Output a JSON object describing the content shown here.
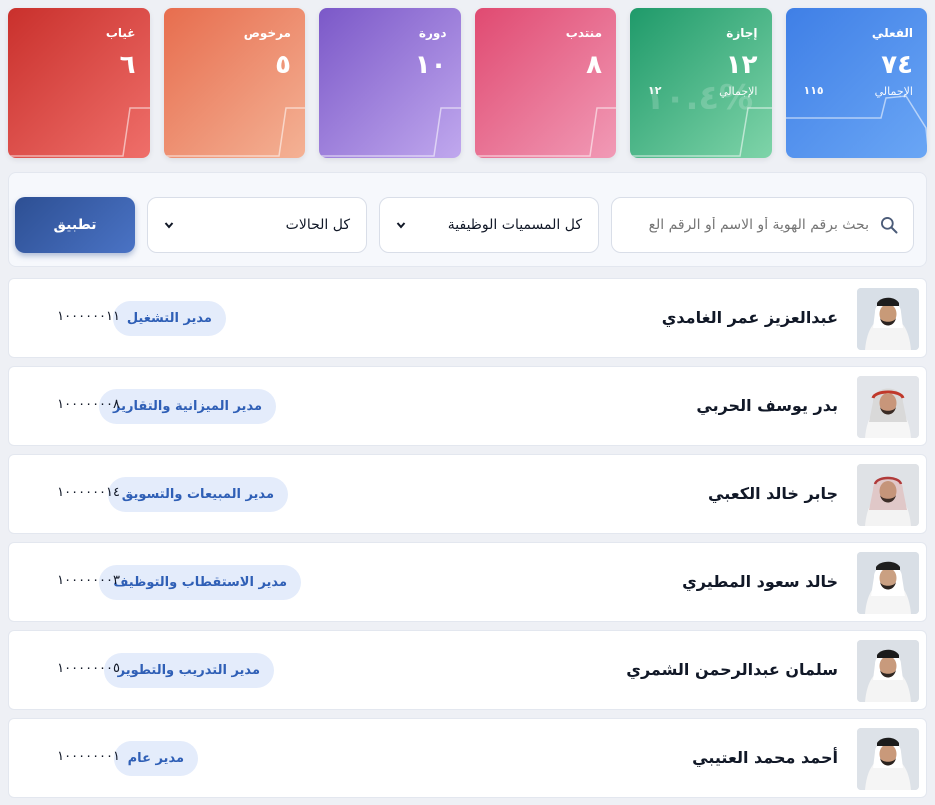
{
  "stats": [
    {
      "label": "الفعلي",
      "value": "٧٤",
      "sublabel": "الإجمالي",
      "subvalue": "١١٥"
    },
    {
      "label": "إجازة",
      "value": "١٢",
      "sublabel": "الإجمالي",
      "subvalue": "١٢",
      "watermark": "%١٠.٤"
    },
    {
      "label": "منتدب",
      "value": "٨"
    },
    {
      "label": "دورة",
      "value": "١٠"
    },
    {
      "label": "مرخوص",
      "value": "٥"
    },
    {
      "label": "غياب",
      "value": "٦"
    }
  ],
  "filters": {
    "search_placeholder": "بحث برقم الهوية أو الاسم أو الرقم الع",
    "job_title_select": "كل المسميات الوظيفية",
    "status_select": "كل الحالات",
    "apply_label": "تطبيق"
  },
  "employees": [
    {
      "name": "عبدالعزيز عمر الغامدي",
      "title": "مدير التشغيل",
      "id": "١٠٠٠٠٠٠١١"
    },
    {
      "name": "بدر يوسف الحربي",
      "title": "مدير الميزانية والتقارير",
      "id": "١٠٠٠٠٠٠٠٨"
    },
    {
      "name": "جابر خالد الكعبي",
      "title": "مدير المبيعات والتسويق",
      "id": "١٠٠٠٠٠٠١٤"
    },
    {
      "name": "خالد سعود المطيري",
      "title": "مدير الاستقطاب والتوظيف",
      "id": "١٠٠٠٠٠٠٠٣"
    },
    {
      "name": "سلمان عبدالرحمن الشمري",
      "title": "مدير التدريب والتطوير",
      "id": "١٠٠٠٠٠٠٠٥"
    },
    {
      "name": "أحمد محمد العتيبي",
      "title": "مدير عام",
      "id": "١٠٠٠٠٠٠٠١"
    }
  ],
  "colors": {
    "accent": "#2d4f93",
    "badge_bg": "#e4ecfb",
    "badge_text": "#2f5fb6"
  }
}
